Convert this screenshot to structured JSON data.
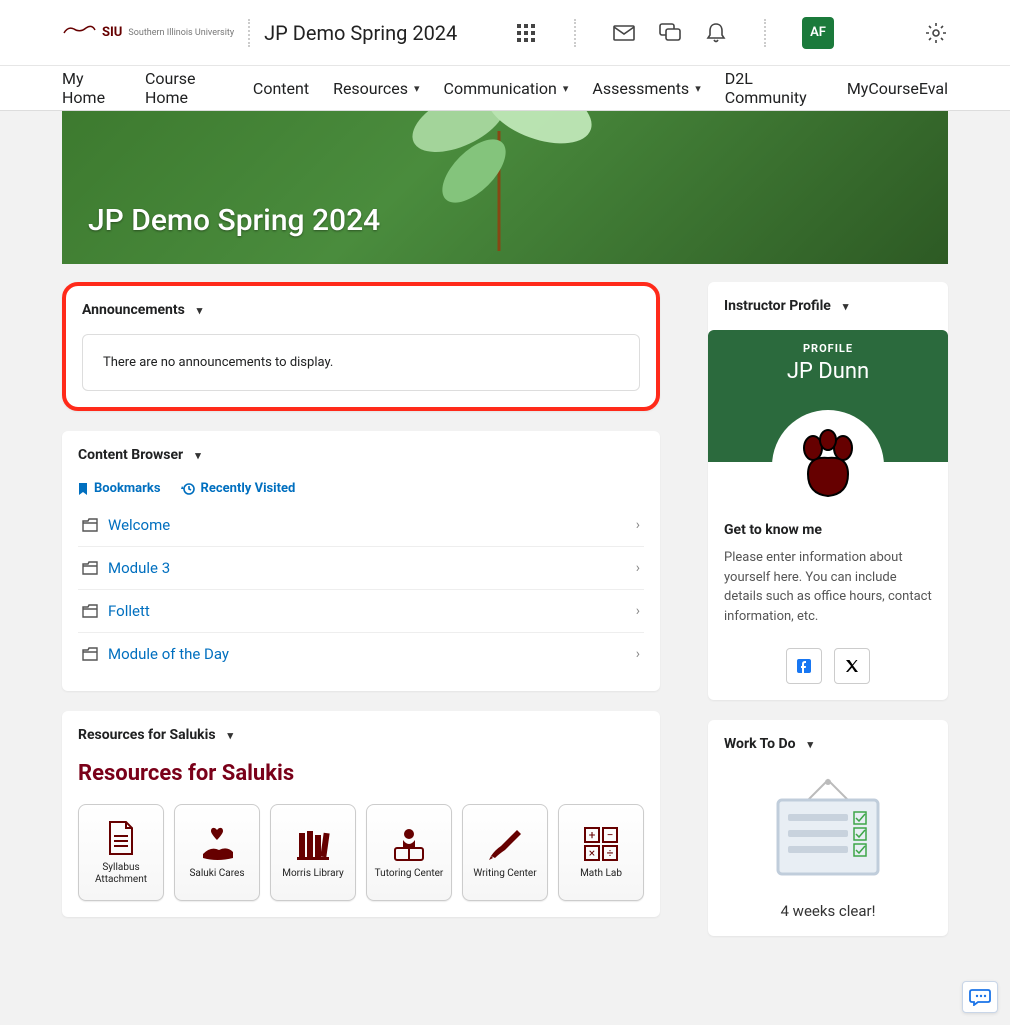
{
  "header": {
    "institution_short": "SIU",
    "institution_long": "Southern Illinois University",
    "course_title": "JP Demo Spring 2024",
    "avatar_initials": "AF"
  },
  "nav": {
    "items": [
      {
        "label": "My Home",
        "dropdown": false
      },
      {
        "label": "Course Home",
        "dropdown": false
      },
      {
        "label": "Content",
        "dropdown": false
      },
      {
        "label": "Resources",
        "dropdown": true
      },
      {
        "label": "Communication",
        "dropdown": true
      },
      {
        "label": "Assessments",
        "dropdown": true
      },
      {
        "label": "D2L Community",
        "dropdown": false
      },
      {
        "label": "MyCourseEval",
        "dropdown": false
      }
    ]
  },
  "banner": {
    "title": "JP Demo Spring 2024"
  },
  "announcements": {
    "title": "Announcements",
    "empty_message": "There are no announcements to display."
  },
  "content_browser": {
    "title": "Content Browser",
    "tabs": {
      "bookmarks": "Bookmarks",
      "recently_visited": "Recently Visited"
    },
    "items": [
      {
        "label": "Welcome"
      },
      {
        "label": "Module 3"
      },
      {
        "label": "Follett"
      },
      {
        "label": "Module of the Day"
      }
    ]
  },
  "resources_widget": {
    "header": "Resources for Salukis",
    "title": "Resources for Salukis",
    "tiles": [
      {
        "label": "Syllabus Attachment"
      },
      {
        "label": "Saluki Cares"
      },
      {
        "label": "Morris Library"
      },
      {
        "label": "Tutoring Center"
      },
      {
        "label": "Writing Center"
      },
      {
        "label": "Math Lab"
      }
    ]
  },
  "instructor": {
    "header": "Instructor Profile",
    "badge": "PROFILE",
    "name": "JP Dunn",
    "subheading": "Get to know me",
    "description": "Please enter information about yourself here. You can include details such as office hours, contact information, etc."
  },
  "work_todo": {
    "header": "Work To Do",
    "status": "4 weeks clear!"
  }
}
